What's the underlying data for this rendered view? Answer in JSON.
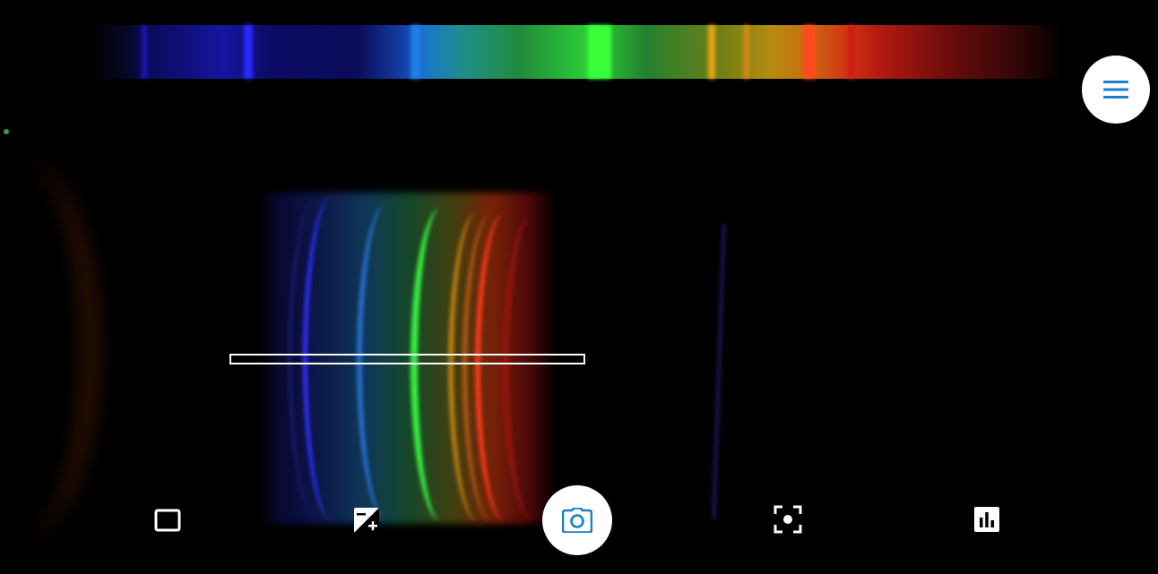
{
  "app": {
    "accent_color": "#1a7fc8",
    "status_dot_color": "#2e9e4a"
  },
  "top_bar": {
    "menu_button_icon": "hamburger-menu-icon"
  },
  "spectrum_strip": {
    "description_icon": "spectrum-preview"
  },
  "camera": {
    "sample_region_icon": "sampling-rectangle"
  },
  "toolbar": {
    "items": [
      {
        "name": "frame-toggle-button",
        "icon": "square-outline-icon"
      },
      {
        "name": "exposure-button",
        "icon": "exposure-plus-minus-icon"
      },
      {
        "name": "capture-button",
        "icon": "camera-icon"
      },
      {
        "name": "focus-button",
        "icon": "center-focus-icon"
      },
      {
        "name": "chart-button",
        "icon": "bar-chart-icon"
      }
    ]
  }
}
